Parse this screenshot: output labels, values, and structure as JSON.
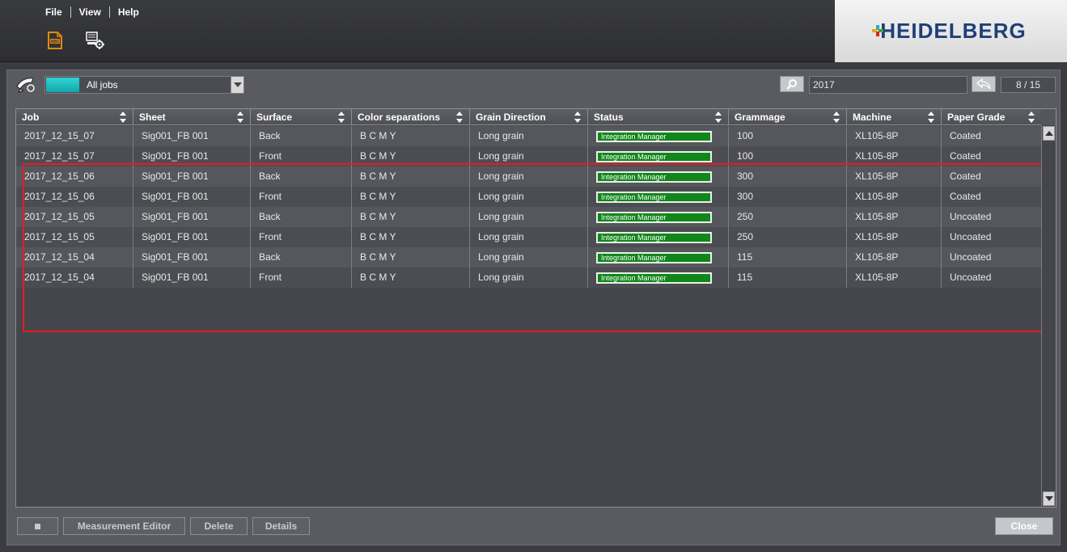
{
  "menu": {
    "file": "File",
    "view": "View",
    "help": "Help"
  },
  "brand": {
    "name": "HEIDELBERG"
  },
  "filter": {
    "label": "All jobs"
  },
  "search": {
    "value": "2017"
  },
  "paging": {
    "label": "8 / 15"
  },
  "table": {
    "columns": [
      "Job",
      "Sheet",
      "Surface",
      "Color separations",
      "Grain Direction",
      "Status",
      "Grammage",
      "Machine",
      "Paper Grade"
    ],
    "rows": [
      [
        "2017_12_15_07",
        "Sig001_FB 001",
        "Back",
        "B C M Y",
        "Long grain",
        "Integration Manager",
        "100",
        "XL105-8P",
        "Coated"
      ],
      [
        "2017_12_15_07",
        "Sig001_FB 001",
        "Front",
        "B C M Y",
        "Long grain",
        "Integration Manager",
        "100",
        "XL105-8P",
        "Coated"
      ],
      [
        "2017_12_15_06",
        "Sig001_FB 001",
        "Back",
        "B C M Y",
        "Long grain",
        "Integration Manager",
        "300",
        "XL105-8P",
        "Coated"
      ],
      [
        "2017_12_15_06",
        "Sig001_FB 001",
        "Front",
        "B C M Y",
        "Long grain",
        "Integration Manager",
        "300",
        "XL105-8P",
        "Coated"
      ],
      [
        "2017_12_15_05",
        "Sig001_FB 001",
        "Back",
        "B C M Y",
        "Long grain",
        "Integration Manager",
        "250",
        "XL105-8P",
        "Uncoated"
      ],
      [
        "2017_12_15_05",
        "Sig001_FB 001",
        "Front",
        "B C M Y",
        "Long grain",
        "Integration Manager",
        "250",
        "XL105-8P",
        "Uncoated"
      ],
      [
        "2017_12_15_04",
        "Sig001_FB 001",
        "Back",
        "B C M Y",
        "Long grain",
        "Integration Manager",
        "115",
        "XL105-8P",
        "Uncoated"
      ],
      [
        "2017_12_15_04",
        "Sig001_FB 001",
        "Front",
        "B C M Y",
        "Long grain",
        "Integration Manager",
        "115",
        "XL105-8P",
        "Uncoated"
      ]
    ]
  },
  "buttons": {
    "measurement_editor": "Measurement Editor",
    "delete": "Delete",
    "details": "Details",
    "close": "Close"
  },
  "icons": {
    "toolbar_left": "job-file-icon",
    "toolbar_right": "monitor-settings-icon",
    "tool": "measuring-device-icon",
    "search": "search-icon",
    "back": "back-arrow-icon"
  },
  "colors": {
    "status_green": "#11861a",
    "filter_cyan": "#1fc3c6",
    "highlight_red": "#e51d24",
    "brand_blue": "#1f3f78"
  }
}
